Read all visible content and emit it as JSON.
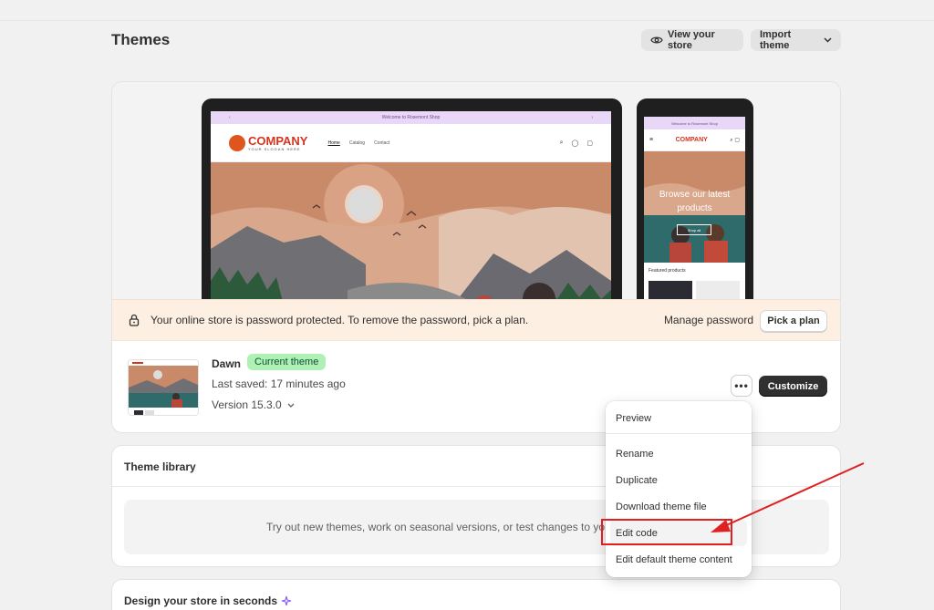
{
  "header": {
    "title": "Themes",
    "view_store_label": "View your store",
    "import_theme_label": "Import theme"
  },
  "preview": {
    "announcement": "Welcome to Rosemont Shop",
    "store_logo": "COMPANY",
    "store_logo_sub": "YOUR SLOGAN HERE",
    "nav": [
      "Home",
      "Catalog",
      "Contact"
    ],
    "mobile_hero_text": "Browse our latest products",
    "mobile_hero_button": "Shop all",
    "mobile_featured": "Featured products"
  },
  "password_banner": {
    "message": "Your online store is password protected. To remove the password, pick a plan.",
    "manage_label": "Manage password",
    "pick_plan_label": "Pick a plan"
  },
  "current_theme": {
    "name": "Dawn",
    "badge": "Current theme",
    "last_saved": "Last saved: 17 minutes ago",
    "version": "Version 15.3.0",
    "more_label": "•••",
    "customize_label": "Customize"
  },
  "theme_library": {
    "title": "Theme library",
    "empty_text": "Try out new themes, work on seasonal versions, or test changes to yo"
  },
  "design_section": {
    "title": "Design your store in seconds"
  },
  "dropdown_menu": {
    "items": [
      "Preview",
      "Rename",
      "Duplicate",
      "Download theme file",
      "Edit code",
      "Edit default theme content"
    ],
    "highlighted": "Edit code"
  },
  "colors": {
    "annotation_red": "#e02020",
    "badge_green": "#aff0b5",
    "password_banner_bg": "#fdefe2",
    "primary_button": "#303030"
  }
}
